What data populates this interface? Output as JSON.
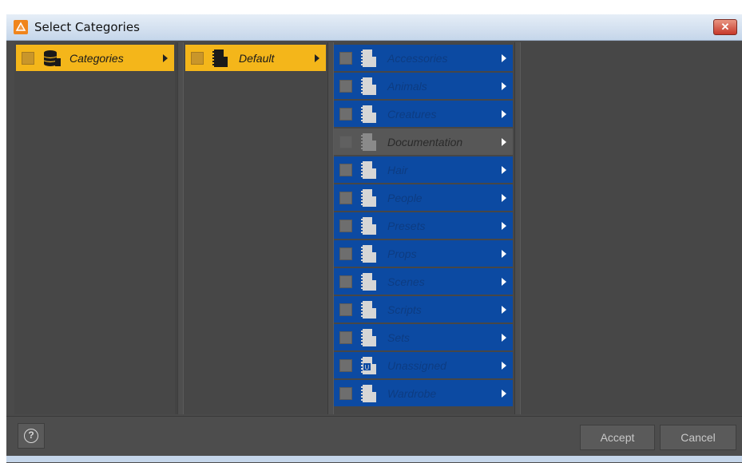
{
  "window": {
    "title": "Select Categories",
    "close_glyph": "✕"
  },
  "columns": {
    "root": {
      "label": "Categories",
      "icon": "database-icon",
      "state": "selected"
    },
    "level1": {
      "label": "Default",
      "icon": "book-icon",
      "state": "selected"
    },
    "level2": [
      {
        "label": "Accessories",
        "state": "highlighted",
        "icon": "book-icon"
      },
      {
        "label": "Animals",
        "state": "highlighted",
        "icon": "book-icon"
      },
      {
        "label": "Creatures",
        "state": "highlighted",
        "icon": "book-icon"
      },
      {
        "label": "Documentation",
        "state": "normal",
        "icon": "book-icon"
      },
      {
        "label": "Hair",
        "state": "highlighted",
        "icon": "book-icon"
      },
      {
        "label": "People",
        "state": "highlighted",
        "icon": "book-icon"
      },
      {
        "label": "Presets",
        "state": "highlighted",
        "icon": "book-icon"
      },
      {
        "label": "Props",
        "state": "highlighted",
        "icon": "book-icon"
      },
      {
        "label": "Scenes",
        "state": "highlighted",
        "icon": "book-icon"
      },
      {
        "label": "Scripts",
        "state": "highlighted",
        "icon": "book-icon"
      },
      {
        "label": "Sets",
        "state": "highlighted",
        "icon": "book-icon"
      },
      {
        "label": "Unassigned",
        "state": "highlighted",
        "icon": "unassigned-book-icon"
      },
      {
        "label": "Wardrobe",
        "state": "highlighted",
        "icon": "book-icon"
      }
    ]
  },
  "footer": {
    "help_glyph": "?",
    "accept_label": "Accept",
    "cancel_label": "Cancel"
  },
  "colors": {
    "selected": "#f4b61a",
    "highlighted": "#0c4aa2",
    "panel": "#474747",
    "titlebar": "#c5d6ea"
  }
}
